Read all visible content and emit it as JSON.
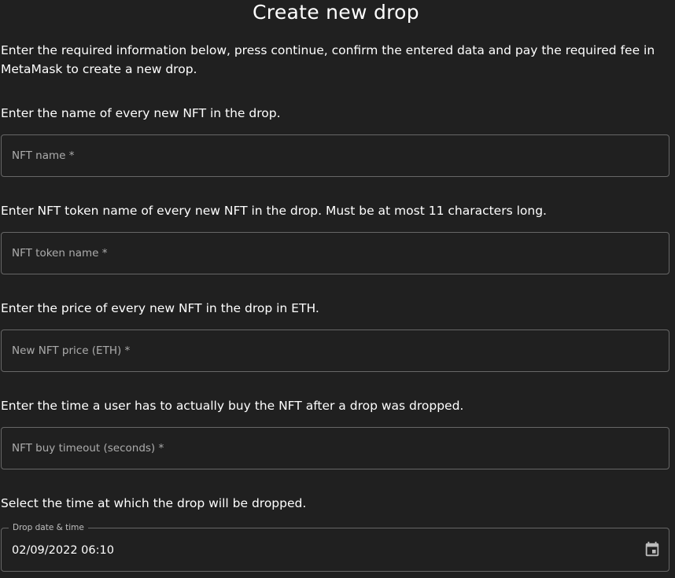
{
  "page": {
    "title": "Create new drop",
    "intro": "Enter the required information below, press continue, confirm the entered data and pay the required fee in MetaMask to create a new drop."
  },
  "form": {
    "nft_name": {
      "description": "Enter the name of every new NFT in the drop.",
      "placeholder": "NFT name *",
      "value": ""
    },
    "nft_token_name": {
      "description": "Enter NFT token name of every new NFT in the drop. Must be at most 11 characters long.",
      "placeholder": "NFT token name *",
      "value": ""
    },
    "nft_price": {
      "description": "Enter the price of every new NFT in the drop in ETH.",
      "placeholder": "New NFT price (ETH) *",
      "value": ""
    },
    "buy_timeout": {
      "description": "Enter the time a user has to actually buy the NFT after a drop was dropped.",
      "placeholder": "NFT buy timeout (seconds) *",
      "value": ""
    },
    "drop_date": {
      "description": "Select the time at which the drop will be dropped.",
      "label": "Drop date & time",
      "value": "02/09/2022 06:10",
      "icon": "calendar-icon"
    }
  },
  "colors": {
    "background": "#202020",
    "text": "#ffffff",
    "border": "rgba(255,255,255,0.32)"
  }
}
